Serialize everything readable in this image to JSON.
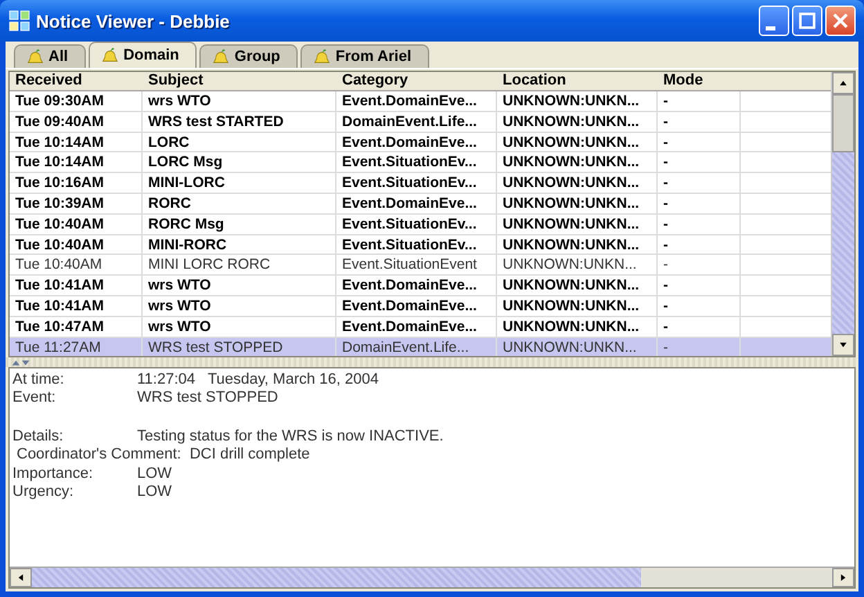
{
  "window": {
    "title": "Notice Viewer - Debbie"
  },
  "tabs": [
    {
      "label": "All",
      "selected": false
    },
    {
      "label": "Domain",
      "selected": true
    },
    {
      "label": "Group",
      "selected": false
    },
    {
      "label": "From Ariel",
      "selected": false
    }
  ],
  "table": {
    "columns": [
      "Received",
      "Subject",
      "Category",
      "Location",
      "Mode"
    ],
    "rows": [
      {
        "cells": [
          "Tue 09:30AM",
          "wrs WTO",
          "Event.DomainEve...",
          "UNKNOWN:UNKN...",
          "-"
        ],
        "unread": true,
        "selected": false
      },
      {
        "cells": [
          "Tue 09:40AM",
          "WRS test STARTED",
          "DomainEvent.Life...",
          "UNKNOWN:UNKN...",
          "-"
        ],
        "unread": true,
        "selected": false
      },
      {
        "cells": [
          "Tue 10:14AM",
          "LORC",
          "Event.DomainEve...",
          "UNKNOWN:UNKN...",
          "-"
        ],
        "unread": true,
        "selected": false
      },
      {
        "cells": [
          "Tue 10:14AM",
          "LORC Msg",
          "Event.SituationEv...",
          "UNKNOWN:UNKN...",
          "-"
        ],
        "unread": true,
        "selected": false
      },
      {
        "cells": [
          "Tue 10:16AM",
          "MINI-LORC",
          "Event.SituationEv...",
          "UNKNOWN:UNKN...",
          "-"
        ],
        "unread": true,
        "selected": false
      },
      {
        "cells": [
          "Tue 10:39AM",
          "RORC",
          "Event.DomainEve...",
          "UNKNOWN:UNKN...",
          "-"
        ],
        "unread": true,
        "selected": false
      },
      {
        "cells": [
          "Tue 10:40AM",
          "RORC Msg",
          "Event.SituationEv...",
          "UNKNOWN:UNKN...",
          "-"
        ],
        "unread": true,
        "selected": false
      },
      {
        "cells": [
          "Tue 10:40AM",
          "MINI-RORC",
          "Event.SituationEv...",
          "UNKNOWN:UNKN...",
          "-"
        ],
        "unread": true,
        "selected": false
      },
      {
        "cells": [
          "Tue 10:40AM",
          "MINI LORC RORC",
          "Event.SituationEvent",
          "UNKNOWN:UNKN...",
          "-"
        ],
        "unread": false,
        "selected": false
      },
      {
        "cells": [
          "Tue 10:41AM",
          "wrs WTO",
          "Event.DomainEve...",
          "UNKNOWN:UNKN...",
          "-"
        ],
        "unread": true,
        "selected": false
      },
      {
        "cells": [
          "Tue 10:41AM",
          "wrs WTO",
          "Event.DomainEve...",
          "UNKNOWN:UNKN...",
          "-"
        ],
        "unread": true,
        "selected": false
      },
      {
        "cells": [
          "Tue 10:47AM",
          "wrs WTO",
          "Event.DomainEve...",
          "UNKNOWN:UNKN...",
          "-"
        ],
        "unread": true,
        "selected": false
      },
      {
        "cells": [
          "Tue 11:27AM",
          "WRS test STOPPED",
          "DomainEvent.Life...",
          "UNKNOWN:UNKN...",
          "-"
        ],
        "unread": false,
        "selected": true
      }
    ]
  },
  "details": [
    [
      {
        "kind": "field",
        "label": "At time:",
        "value": "11:27:04   Tuesday, March 16, 2004"
      },
      {
        "kind": "field",
        "label": "Event:",
        "value": "WRS test STOPPED"
      }
    ],
    [
      {
        "kind": "field",
        "label": "Details:",
        "value": "Testing status for the WRS is now INACTIVE."
      },
      {
        "kind": "line",
        "text": "Coordinator's Comment:  DCI drill complete"
      },
      {
        "kind": "field",
        "label": "Importance:",
        "value": "LOW"
      },
      {
        "kind": "field",
        "label": "Urgency:",
        "value": "LOW"
      }
    ]
  ]
}
